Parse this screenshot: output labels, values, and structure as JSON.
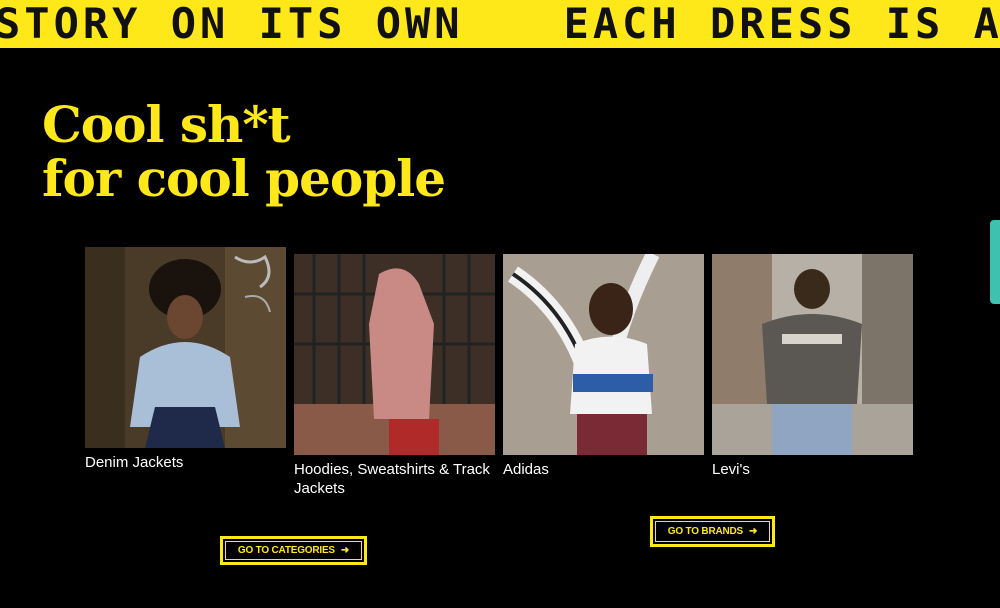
{
  "marquee": {
    "text_a": "STORY ON ITS OWN",
    "text_b": "EACH DRESS IS A ST"
  },
  "headline": {
    "line1": "Cool sh*t",
    "line2": "for cool people"
  },
  "cards": [
    {
      "label": "Denim Jackets"
    },
    {
      "label": "Hoodies, Sweatshirts & Track Jackets"
    },
    {
      "label": "Adidas"
    },
    {
      "label": "Levi's"
    }
  ],
  "buttons": {
    "categories": "GO TO CATEGORIES",
    "brands": "GO TO BRANDS",
    "arrow_icon": "arrow-right-icon"
  },
  "colors": {
    "accent": "#ffe81a",
    "background": "#000000",
    "side_tab": "#3fc1b0"
  }
}
